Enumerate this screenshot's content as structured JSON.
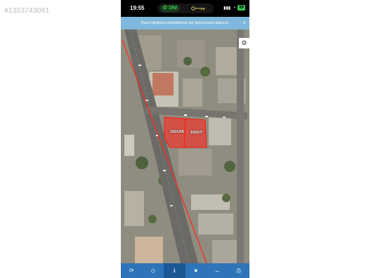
{
  "listing_id": "#1303743091",
  "status": {
    "time": "19:55",
    "call": "16d",
    "battery": "89"
  },
  "banner": {
    "text": "Parsel bilgilerini görüntülemek için ilgili parsele tıklayınız.",
    "close": "×"
  },
  "map": {
    "parcels": [
      {
        "label": "1501/56"
      },
      {
        "label": "1501/7"
      }
    ]
  },
  "toolbar": {
    "items": [
      {
        "icon": "refresh-icon",
        "glyph": "⟳"
      },
      {
        "icon": "locate-icon",
        "glyph": "◇"
      },
      {
        "icon": "info-icon",
        "glyph": "i",
        "active": true
      },
      {
        "icon": "star-icon",
        "glyph": "★"
      },
      {
        "icon": "ruler-icon",
        "glyph": "↔"
      },
      {
        "icon": "print-icon",
        "glyph": "⎙"
      }
    ]
  },
  "colors": {
    "accent": "#2d74b8",
    "banner": "#7fb8dc",
    "boundary": "#ff2a1a"
  }
}
